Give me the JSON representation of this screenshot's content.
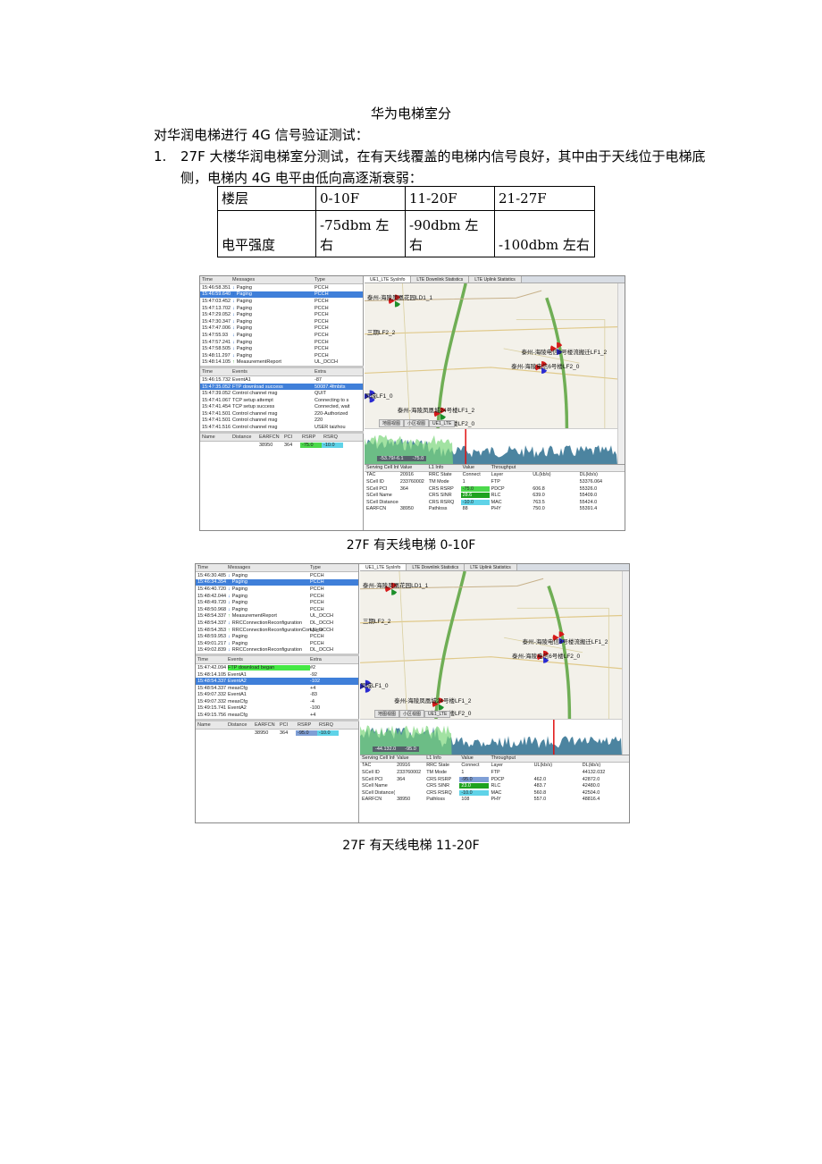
{
  "doc": {
    "title": "华为电梯室分",
    "intro": "对华润电梯进行 4G 信号验证测试：",
    "item_num": "1.",
    "item_text": "27F 大楼华润电梯室分测试，在有天线覆盖的电梯内信号良好，其中由于天线位于电梯底侧，电梯内 4G 电平由低向高逐渐衰弱："
  },
  "level_table": {
    "header": [
      "楼层",
      "0-10F",
      "11-20F",
      "21-27F"
    ],
    "row_label": "电平强度",
    "values": [
      "-75dbm 左右",
      "-90dbm 左右",
      "-100dbm 左右"
    ]
  },
  "shot1": {
    "caption": "27F 有天线电梯 0-10F",
    "msg_header": [
      "Time",
      "Messages",
      "Type"
    ],
    "messages": [
      [
        "15:46:58.351",
        "Paging",
        "PCCH"
      ],
      [
        "15:46:59.640",
        "Paging",
        "PCCH"
      ],
      [
        "15:47:03.452",
        "Paging",
        "PCCH"
      ],
      [
        "15:47:13.702",
        "Paging",
        "PCCH"
      ],
      [
        "15:47:29.052",
        "Paging",
        "PCCH"
      ],
      [
        "15:47:30.347",
        "Paging",
        "PCCH"
      ],
      [
        "15:47:47.006",
        "Paging",
        "PCCH"
      ],
      [
        "15:47:55.93",
        "Paging",
        "PCCH"
      ],
      [
        "15:47:57.241",
        "Paging",
        "PCCH"
      ],
      [
        "15:47:58.505",
        "Paging",
        "PCCH"
      ],
      [
        "15:48:11.297",
        "Paging",
        "PCCH"
      ],
      [
        "15:48:14.105",
        "MeasurementReport",
        "UL_DCCH"
      ]
    ],
    "msg_selected": 1,
    "evt_header": [
      "Time",
      "Events",
      "Extra"
    ],
    "events": [
      [
        "15:46:15.732",
        "EventA1",
        "-87"
      ],
      [
        "15:47:35.052",
        "FTP download success",
        "50087.4fmbits"
      ],
      [
        "15:47:39.052",
        "Control channel msg",
        "QUIT"
      ],
      [
        "15:47:41.067",
        "TCP setup attempt",
        "Connecting to s"
      ],
      [
        "15:47:41.454",
        "TCP setup success",
        "Connected, wait"
      ],
      [
        "15:47:41.501",
        "Control channel msg",
        "220-Authorized"
      ],
      [
        "15:47:41.501",
        "Control channel msg",
        "220"
      ],
      [
        "15:47:41.516",
        "Control channel msg",
        "USER taizhou"
      ]
    ],
    "evt_selected": 1,
    "cell_header": [
      "Name",
      "Distance",
      "EARFCN",
      "PCI",
      "RSRP",
      "RSRQ"
    ],
    "cell_row": [
      "",
      "",
      "38950",
      "364",
      "-75.0",
      "-10.0"
    ],
    "tabs": [
      "UE1_LTE SysInfo",
      "LTE Downlink Statistics",
      "LTE Uplink Statistics"
    ],
    "map_labels": [
      "泰州-海陵凤凰花园LD1_1",
      "三期LF2_2",
      "泰州-海陵电信8号楼流搬迁LF1_2",
      "泰州-海陵电信6号楼LF2_0",
      "凤城LF1_0",
      "泰州-海陵凤凰城24号楼LF1_2",
      "泰州-海陵凤凰城24号楼LF2_0"
    ],
    "map_tabs": [
      "地图视图",
      "小区视图",
      "UE1_LTE"
    ],
    "chart_readout": [
      "-53.79/-6.1",
      "-75.0"
    ],
    "serving_header": [
      "Serving Cell Info",
      "Value",
      "L1 Info",
      "Value",
      "Throughput",
      "",
      ""
    ],
    "serving_rows": [
      [
        "TAC",
        "20916",
        "RRC State",
        "Connect",
        "Layer",
        "UL(kb/s)",
        "DL(kb/s)"
      ],
      [
        "SCell ID",
        "233760002",
        "TM Mode",
        "1",
        "FTP",
        "",
        "53376.064"
      ],
      [
        "SCell PCI",
        "364",
        "CRS RSRP",
        "-75.0",
        "PDCP",
        "606.8",
        "55326.0"
      ],
      [
        "SCell Name",
        "",
        "CRS SINR",
        "28.6",
        "RLC",
        "639.0",
        "55409.0"
      ],
      [
        "SCell Distance(km)",
        "",
        "CRS RSRQ",
        "-10.0",
        "MAC",
        "763.5",
        "55424.0"
      ],
      [
        "EARFCN",
        "38950",
        "Pathloss",
        "88",
        "PHY",
        "750.0",
        "55391.4"
      ]
    ]
  },
  "shot2": {
    "caption": "27F 有天线电梯 11-20F",
    "msg_header": [
      "Time",
      "Messages",
      "Type"
    ],
    "messages": [
      [
        "15:46:30.485",
        "Paging",
        "PCCH"
      ],
      [
        "15:46:34.354",
        "Paging",
        "PCCH"
      ],
      [
        "15:46:40.720",
        "Paging",
        "PCCH"
      ],
      [
        "15:48:42.044",
        "Paging",
        "PCCH"
      ],
      [
        "15:48:49.720",
        "Paging",
        "PCCH"
      ],
      [
        "15:48:50.968",
        "Paging",
        "PCCH"
      ],
      [
        "15:48:54.337",
        "MeasurementReport",
        "UL_DCCH"
      ],
      [
        "15:48:54.337",
        "RRCConnectionReconfiguration",
        "DL_DCCH"
      ],
      [
        "15:48:54.353",
        "RRCConnectionReconfigurationComplete",
        "UL_DCCH"
      ],
      [
        "15:48:59.953",
        "Paging",
        "PCCH"
      ],
      [
        "15:49:01.217",
        "Paging",
        "PCCH"
      ],
      [
        "15:49:02.839",
        "RRCConnectionReconfiguration",
        "DL_DCCH"
      ]
    ],
    "msg_selected": 1,
    "evt_header": [
      "Time",
      "Events",
      "Extra"
    ],
    "events": [
      [
        "15:47:42.094",
        "FTP download began",
        "#2"
      ],
      [
        "15:48:14.105",
        "EventA1",
        "-92"
      ],
      [
        "15:48:54.337",
        "EventA2",
        "-102"
      ],
      [
        "15:48:54.337",
        "measCfg",
        "+4"
      ],
      [
        "15:49:07.332",
        "EventA1",
        "-83"
      ],
      [
        "15:49:07.332",
        "measCfg",
        "-4"
      ],
      [
        "15:49:15.741",
        "EventA2",
        "-100"
      ],
      [
        "15:49:15.756",
        "measCfg",
        "+4"
      ]
    ],
    "evt_selected": 2,
    "evt_green": 0,
    "cell_header": [
      "Name",
      "Distance",
      "EARFCN",
      "PCI",
      "RSRP",
      "RSRQ"
    ],
    "cell_row": [
      "",
      "",
      "38950",
      "364",
      "-95.0",
      "-10.0"
    ],
    "tabs": [
      "UE1_LTE SysInfo",
      "LTE Downlink Statistics",
      "LTE Uplink Statistics"
    ],
    "map_labels": [
      "泰州-海陵凤凰花园LD1_1",
      "三期LF2_2",
      "泰州-海陵电信8号楼流搬迁LF1_2",
      "泰州-海陵电信6号楼LF2_0",
      "凤城LF1_0",
      "泰州-海陵凤凰城24号楼LF1_2",
      "泰州-海陵凤凰城24号楼LF2_0"
    ],
    "map_tabs": [
      "地图视图",
      "小区视图",
      "UE1_LTE"
    ],
    "chart_readout": [
      "-44.132.0",
      "-95.0"
    ],
    "serving_header": [
      "Serving Cell Info",
      "Value",
      "L1 Info",
      "Value",
      "Throughput",
      "",
      ""
    ],
    "serving_rows": [
      [
        "TAC",
        "20916",
        "RRC State",
        "Connect",
        "Layer",
        "UL(kb/s)",
        "DL(kb/s)"
      ],
      [
        "SCell ID",
        "233760002",
        "TM Mode",
        "1",
        "FTP",
        "",
        "44132.032"
      ],
      [
        "SCell PCI",
        "364",
        "CRS RSRP",
        "-95.0",
        "PDCP",
        "462.0",
        "42872.0"
      ],
      [
        "SCell Name",
        "",
        "CRS SINR",
        "23.0",
        "RLC",
        "483.7",
        "42480.0"
      ],
      [
        "SCell Distance(km)",
        "",
        "CRS RSRQ",
        "-10.0",
        "MAC",
        "560.8",
        "42504.0"
      ],
      [
        "EARFCN",
        "38950",
        "Pathloss",
        "108",
        "PHY",
        "557.0",
        "48816.4"
      ]
    ]
  },
  "colors": {
    "selected_row": "#3f7fd9",
    "highlight_green": "#45e845",
    "rsrp_cell": "#4cd94c",
    "rsrq_cell": "#5fd3e8",
    "map_bg": "#f3f1ea",
    "road": "#6fae55"
  }
}
